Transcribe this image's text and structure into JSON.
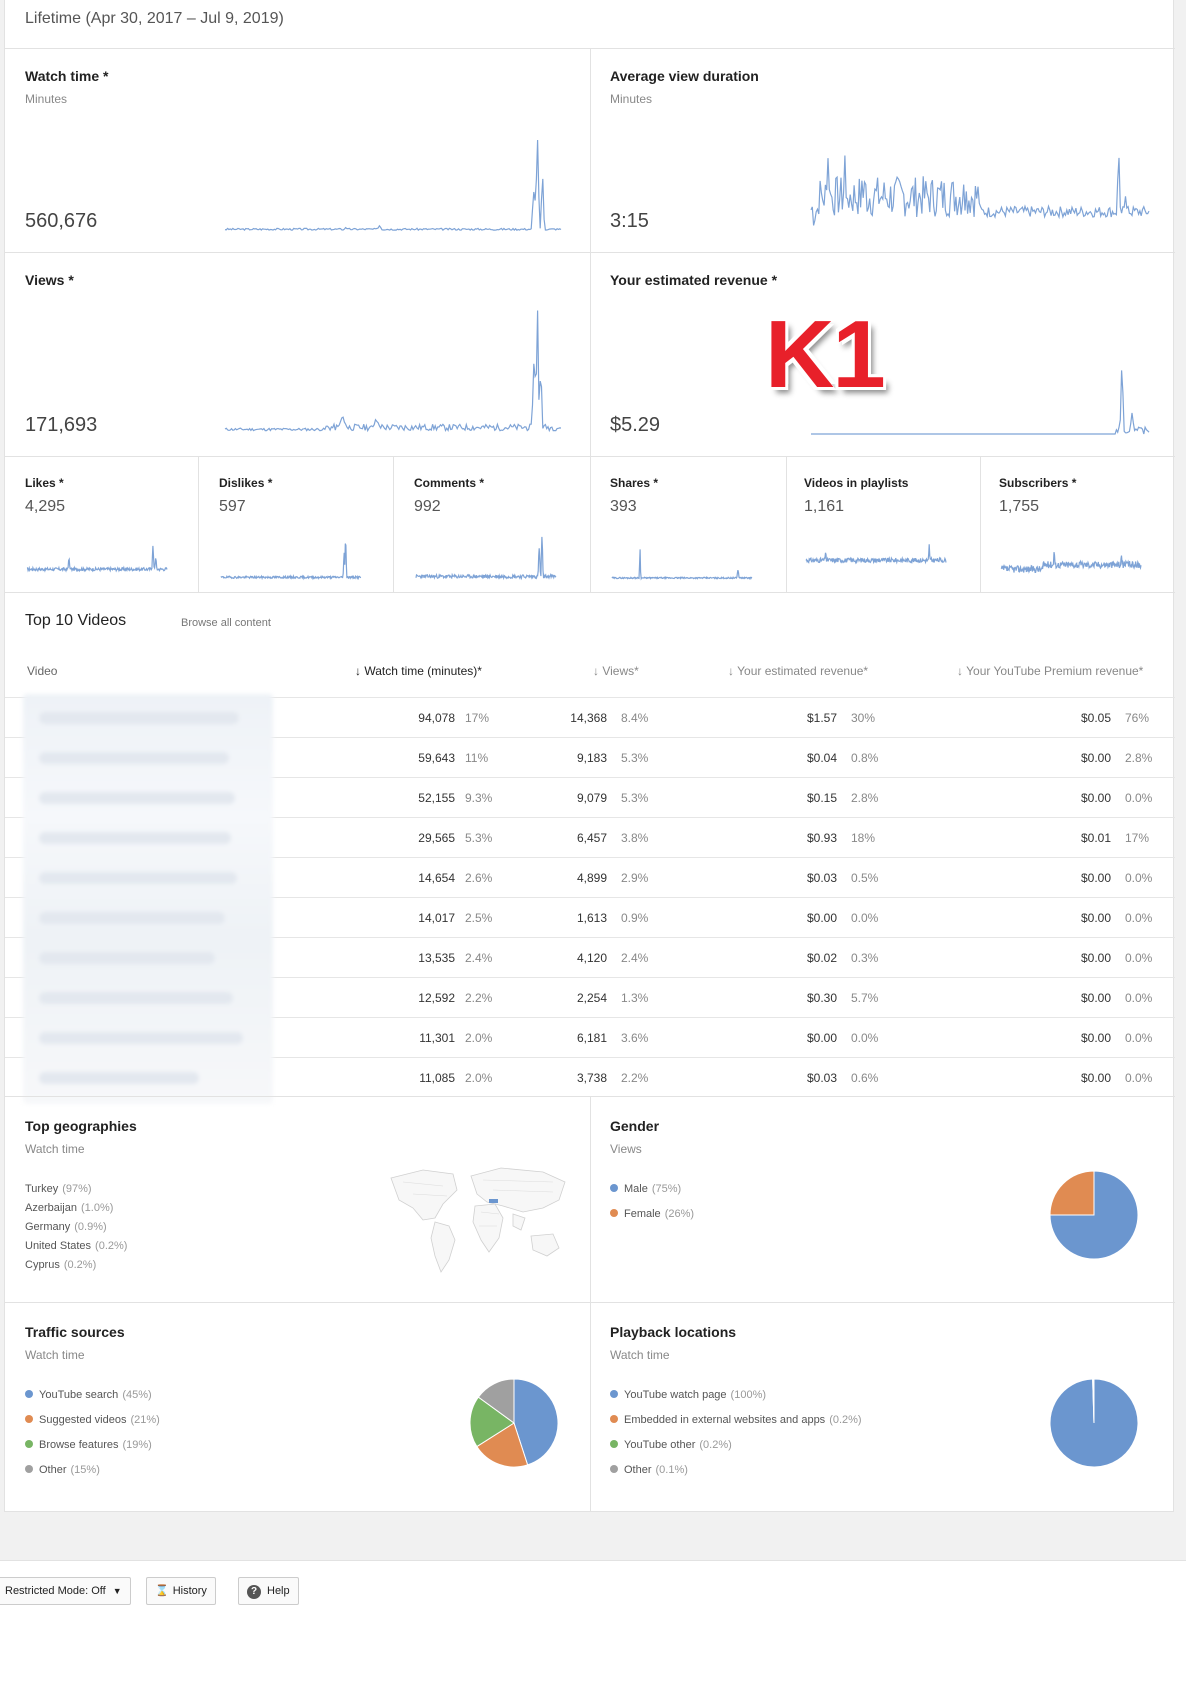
{
  "range": "Lifetime (Apr 30, 2017 – Jul 9, 2019)",
  "watermark": "K1",
  "metrics": [
    {
      "title": "Watch time *",
      "sub": "Minutes",
      "value": "560,676"
    },
    {
      "title": "Average view duration",
      "sub": "Minutes",
      "value": "3:15"
    },
    {
      "title": "Views *",
      "sub": "",
      "value": "171,693"
    },
    {
      "title": "Your estimated revenue *",
      "sub": "",
      "value": "$5.29"
    }
  ],
  "small_metrics": [
    {
      "title": "Likes *",
      "value": "4,295"
    },
    {
      "title": "Dislikes *",
      "value": "597"
    },
    {
      "title": "Comments *",
      "value": "992"
    },
    {
      "title": "Shares *",
      "value": "393"
    },
    {
      "title": "Videos in playlists",
      "value": "1,161"
    },
    {
      "title": "Subscribers *",
      "value": "1,755"
    }
  ],
  "top_videos": {
    "title": "Top 10 Videos",
    "browse_link": "Browse all content",
    "headers": {
      "video": "Video",
      "watch": "Watch time (minutes)*",
      "views": "Views*",
      "revenue": "Your estimated revenue*",
      "premium": "Your YouTube Premium revenue*"
    },
    "rows": [
      {
        "watch": "94,078",
        "watch_pct": "17%",
        "views": "14,368",
        "views_pct": "8.4%",
        "rev": "$1.57",
        "rev_pct": "30%",
        "prem": "$0.05",
        "prem_pct": "76%"
      },
      {
        "watch": "59,643",
        "watch_pct": "11%",
        "views": "9,183",
        "views_pct": "5.3%",
        "rev": "$0.04",
        "rev_pct": "0.8%",
        "prem": "$0.00",
        "prem_pct": "2.8%"
      },
      {
        "watch": "52,155",
        "watch_pct": "9.3%",
        "views": "9,079",
        "views_pct": "5.3%",
        "rev": "$0.15",
        "rev_pct": "2.8%",
        "prem": "$0.00",
        "prem_pct": "0.0%"
      },
      {
        "watch": "29,565",
        "watch_pct": "5.3%",
        "views": "6,457",
        "views_pct": "3.8%",
        "rev": "$0.93",
        "rev_pct": "18%",
        "prem": "$0.01",
        "prem_pct": "17%"
      },
      {
        "watch": "14,654",
        "watch_pct": "2.6%",
        "views": "4,899",
        "views_pct": "2.9%",
        "rev": "$0.03",
        "rev_pct": "0.5%",
        "prem": "$0.00",
        "prem_pct": "0.0%"
      },
      {
        "watch": "14,017",
        "watch_pct": "2.5%",
        "views": "1,613",
        "views_pct": "0.9%",
        "rev": "$0.00",
        "rev_pct": "0.0%",
        "prem": "$0.00",
        "prem_pct": "0.0%"
      },
      {
        "watch": "13,535",
        "watch_pct": "2.4%",
        "views": "4,120",
        "views_pct": "2.4%",
        "rev": "$0.02",
        "rev_pct": "0.3%",
        "prem": "$0.00",
        "prem_pct": "0.0%"
      },
      {
        "watch": "12,592",
        "watch_pct": "2.2%",
        "views": "2,254",
        "views_pct": "1.3%",
        "rev": "$0.30",
        "rev_pct": "5.7%",
        "prem": "$0.00",
        "prem_pct": "0.0%"
      },
      {
        "watch": "11,301",
        "watch_pct": "2.0%",
        "views": "6,181",
        "views_pct": "3.6%",
        "rev": "$0.00",
        "rev_pct": "0.0%",
        "prem": "$0.00",
        "prem_pct": "0.0%"
      },
      {
        "watch": "11,085",
        "watch_pct": "2.0%",
        "views": "3,738",
        "views_pct": "2.2%",
        "rev": "$0.03",
        "rev_pct": "0.6%",
        "prem": "$0.00",
        "prem_pct": "0.0%"
      }
    ]
  },
  "geographies": {
    "title": "Top geographies",
    "sub": "Watch time",
    "items": [
      {
        "name": "Turkey",
        "pct": "(97%)"
      },
      {
        "name": "Azerbaijan",
        "pct": "(1.0%)"
      },
      {
        "name": "Germany",
        "pct": "(0.9%)"
      },
      {
        "name": "United States",
        "pct": "(0.2%)"
      },
      {
        "name": "Cyprus",
        "pct": "(0.2%)"
      }
    ]
  },
  "gender": {
    "title": "Gender",
    "sub": "Views",
    "items": [
      {
        "name": "Male",
        "pct": "(75%)",
        "value": 75,
        "color": "#6b96cf"
      },
      {
        "name": "Female",
        "pct": "(26%)",
        "value": 25,
        "color": "#e08b52"
      }
    ]
  },
  "traffic": {
    "title": "Traffic sources",
    "sub": "Watch time",
    "items": [
      {
        "name": "YouTube search",
        "pct": "(45%)",
        "value": 45,
        "color": "#6b96cf"
      },
      {
        "name": "Suggested videos",
        "pct": "(21%)",
        "value": 21,
        "color": "#e08b52"
      },
      {
        "name": "Browse features",
        "pct": "(19%)",
        "value": 19,
        "color": "#78b564"
      },
      {
        "name": "Other",
        "pct": "(15%)",
        "value": 15,
        "color": "#a0a0a0"
      }
    ]
  },
  "playback": {
    "title": "Playback locations",
    "sub": "Watch time",
    "items": [
      {
        "name": "YouTube watch page",
        "pct": "(100%)",
        "value": 99.5,
        "color": "#6b96cf"
      },
      {
        "name": "Embedded in external websites and apps",
        "pct": "(0.2%)",
        "value": 0.2,
        "color": "#e08b52"
      },
      {
        "name": "YouTube other",
        "pct": "(0.2%)",
        "value": 0.2,
        "color": "#78b564"
      },
      {
        "name": "Other",
        "pct": "(0.1%)",
        "value": 0.1,
        "color": "#a0a0a0"
      }
    ]
  },
  "footer": {
    "restricted": "Restricted Mode: Off",
    "history": "History",
    "help": "Help"
  },
  "colors": {
    "spark": "#7ea3d6"
  }
}
